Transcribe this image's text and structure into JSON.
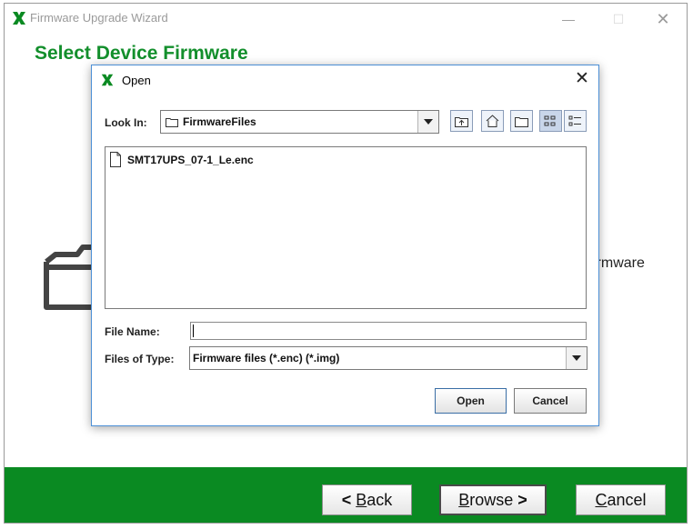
{
  "wizard": {
    "title": "Firmware Upgrade Wizard",
    "heading": "Select Device Firmware",
    "partial_text": "irmware",
    "buttons": {
      "back_arrow": "<",
      "back_mnemonic": "B",
      "back_rest": "ack",
      "browse_mnemonic": "B",
      "browse_rest": "rowse",
      "browse_arrow": ">",
      "cancel_mnemonic": "C",
      "cancel_rest": "ancel"
    },
    "window_controls": {
      "minimize": "—",
      "maximize": "☐",
      "close": "✕"
    },
    "accent_color": "#0a8a22",
    "heading_color": "#138f2c"
  },
  "open_dialog": {
    "title": "Open",
    "close_glyph": "✕",
    "look_in": {
      "label": "Look In:",
      "value": "FirmwareFiles"
    },
    "toolbar": [
      "up-one-level-icon",
      "home-icon",
      "new-folder-icon",
      "list-view-icon",
      "details-view-icon"
    ],
    "files": [
      {
        "name": "SMT17UPS_07-1_Le.enc",
        "icon": "file-icon"
      }
    ],
    "file_name": {
      "label": "File Name:",
      "value": ""
    },
    "files_of_type": {
      "label": "Files of Type:",
      "value": "Firmware files (*.enc) (*.img)"
    },
    "buttons": {
      "open": "Open",
      "cancel": "Cancel"
    },
    "border_color": "#4c8fd6"
  }
}
